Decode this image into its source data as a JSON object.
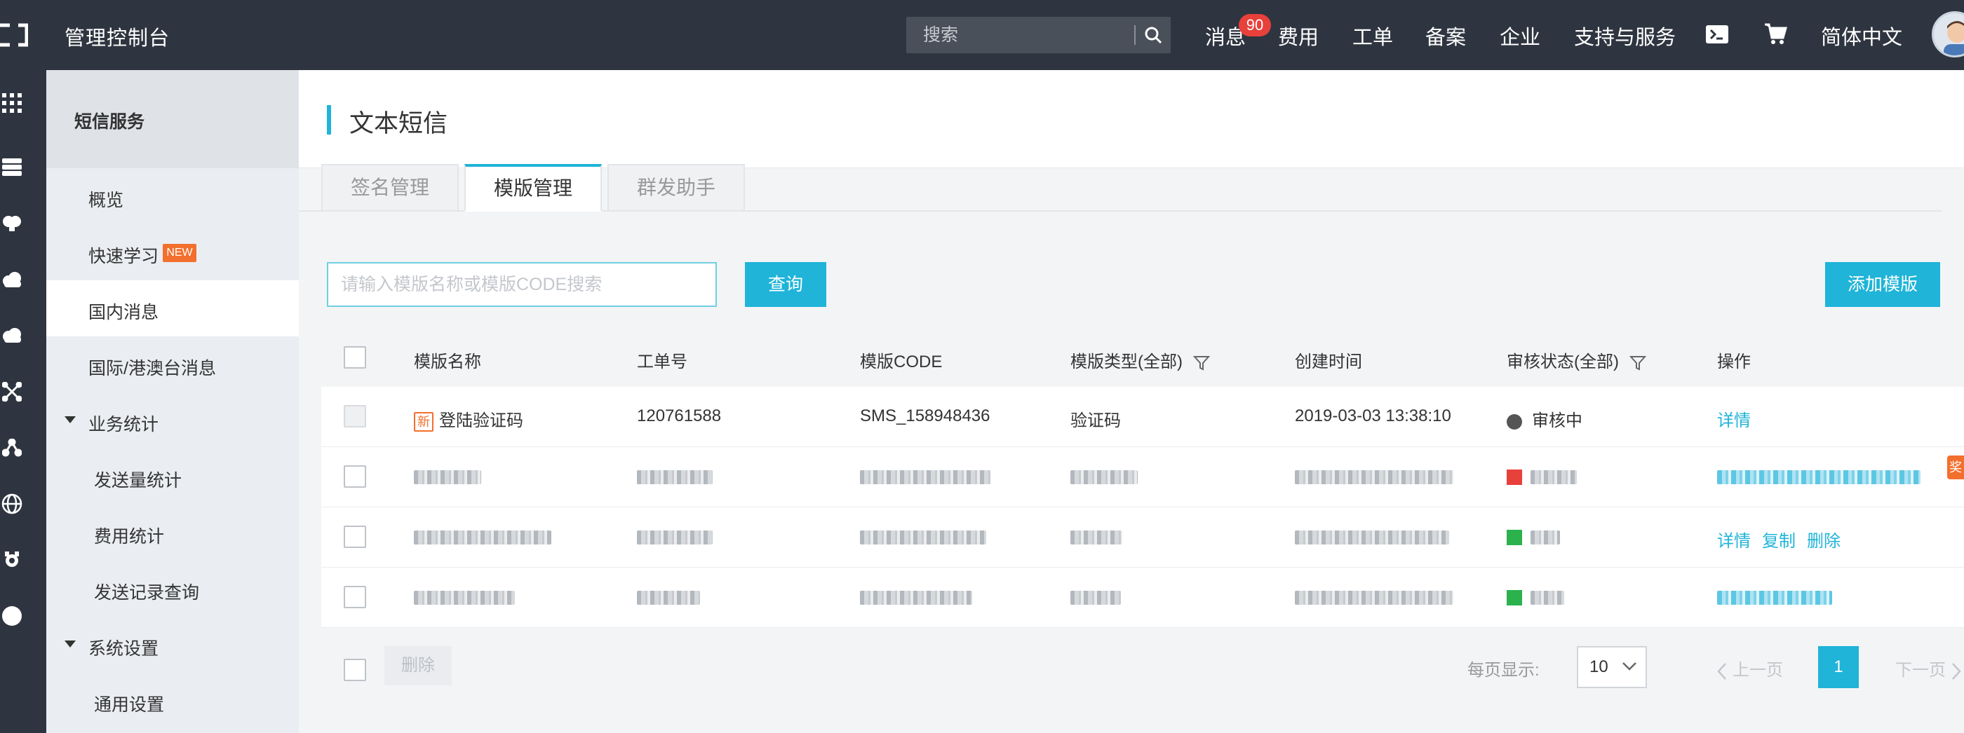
{
  "header": {
    "title": "管理控制台",
    "search_placeholder": "搜索",
    "messages_label": "消息",
    "messages_badge": "90",
    "nav": [
      "费用",
      "工单",
      "备案",
      "企业",
      "支持与服务"
    ],
    "language": "简体中文",
    "icons": [
      "logo-icon",
      "search-icon",
      "terminal-icon",
      "cart-icon",
      "avatar"
    ]
  },
  "rail": {
    "icons": [
      "grid-icon",
      "server-icon",
      "brain-icon",
      "cloud-icon",
      "cloud-upload-icon",
      "network-icon",
      "nodes-icon",
      "globe-icon",
      "cog-icon",
      "circle-icon"
    ]
  },
  "sidebar": {
    "title": "短信服务",
    "items": [
      {
        "label": "概览"
      },
      {
        "label": "快速学习",
        "badge": "NEW"
      },
      {
        "label": "国内消息",
        "active": true
      },
      {
        "label": "国际/港澳台消息"
      },
      {
        "label": "业务统计",
        "expanded": true
      },
      {
        "label": "发送量统计"
      },
      {
        "label": "费用统计"
      },
      {
        "label": "发送记录查询"
      },
      {
        "label": "系统设置",
        "expanded": true
      },
      {
        "label": "通用设置"
      }
    ]
  },
  "page": {
    "title": "文本短信",
    "tabs": [
      {
        "label": "签名管理"
      },
      {
        "label": "模版管理",
        "active": true
      },
      {
        "label": "群发助手"
      }
    ],
    "search_placeholder": "请输入模版名称或模版CODE搜索",
    "query_button": "查询",
    "add_button": "添加模版"
  },
  "table": {
    "columns": [
      "模版名称",
      "工单号",
      "模版CODE",
      "模版类型(全部)",
      "创建时间",
      "审核状态(全部)",
      "操作"
    ],
    "rows": [
      {
        "new_tag": "新",
        "name": "登陆验证码",
        "order_no": "120761588",
        "code": "SMS_158948436",
        "type": "验证码",
        "created": "2019-03-03 13:38:10",
        "status": "审核中",
        "status_color": "#555555",
        "actions": [
          "详情"
        ]
      },
      {
        "blurred": true,
        "status_color": "#e8403a"
      },
      {
        "blurred": true,
        "status_color": "#2bb24c",
        "actions": [
          "详情",
          "复制",
          "删除"
        ]
      },
      {
        "blurred": true,
        "status_color": "#2bb24c"
      }
    ],
    "footer": {
      "delete_button": "删除",
      "page_size_label": "每页显示:",
      "page_size": "10",
      "prev": "上一页",
      "current_page": "1",
      "next": "下一页"
    }
  },
  "side_marker": "奖",
  "colors": {
    "accent": "#1fb4d8",
    "topbar": "#2f3540",
    "badge": "#e8403a",
    "new_tag": "#f36f2e"
  }
}
